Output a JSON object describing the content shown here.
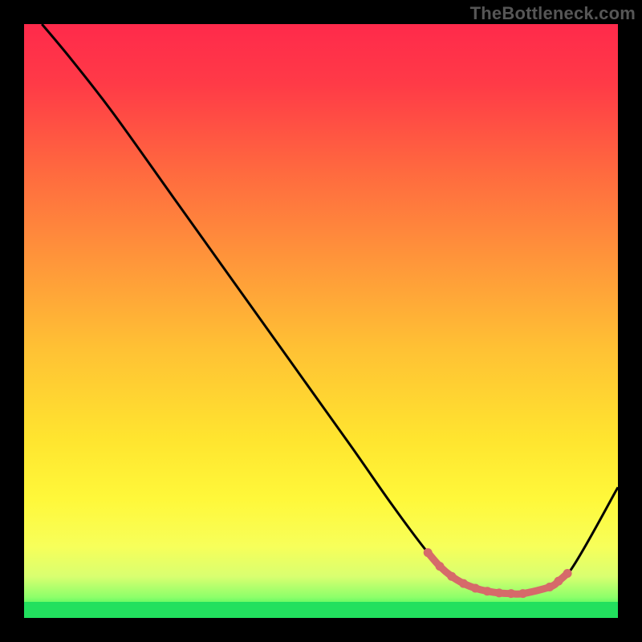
{
  "watermark": "TheBottleneck.com",
  "colors": {
    "background": "#000000",
    "curve": "#000000",
    "marker": "#d66a6a",
    "bottom_band": "#22e05e",
    "gradient_stops": [
      {
        "offset": 0.0,
        "color": "#ff2a4b"
      },
      {
        "offset": 0.1,
        "color": "#ff3a47"
      },
      {
        "offset": 0.25,
        "color": "#ff6a3f"
      },
      {
        "offset": 0.4,
        "color": "#ff963a"
      },
      {
        "offset": 0.55,
        "color": "#ffc234"
      },
      {
        "offset": 0.7,
        "color": "#ffe52f"
      },
      {
        "offset": 0.8,
        "color": "#fff83a"
      },
      {
        "offset": 0.88,
        "color": "#f7ff5a"
      },
      {
        "offset": 0.93,
        "color": "#d9ff70"
      },
      {
        "offset": 0.965,
        "color": "#8dff6a"
      },
      {
        "offset": 0.985,
        "color": "#3df55f"
      },
      {
        "offset": 1.0,
        "color": "#16d856"
      }
    ]
  },
  "chart_data": {
    "type": "line",
    "title": "",
    "xlabel": "",
    "ylabel": "",
    "xlim": [
      0,
      100
    ],
    "ylim": [
      0,
      100
    ],
    "series": [
      {
        "name": "bottleneck-curve",
        "x": [
          3,
          8,
          15,
          25,
          35,
          45,
          55,
          62,
          68,
          72,
          76,
          80,
          84,
          88,
          92,
          100
        ],
        "y": [
          100,
          94,
          85,
          71,
          57,
          43,
          29,
          19,
          11,
          7,
          5,
          4,
          4,
          5,
          8,
          22
        ]
      }
    ],
    "markers": {
      "name": "highlight-range",
      "x": [
        68,
        70,
        72,
        74,
        76,
        78,
        80,
        82,
        84,
        88.5,
        90,
        91.5
      ],
      "y": [
        11,
        8.7,
        7,
        5.8,
        5,
        4.5,
        4.2,
        4.1,
        4.1,
        5.2,
        6.2,
        7.5
      ]
    }
  }
}
